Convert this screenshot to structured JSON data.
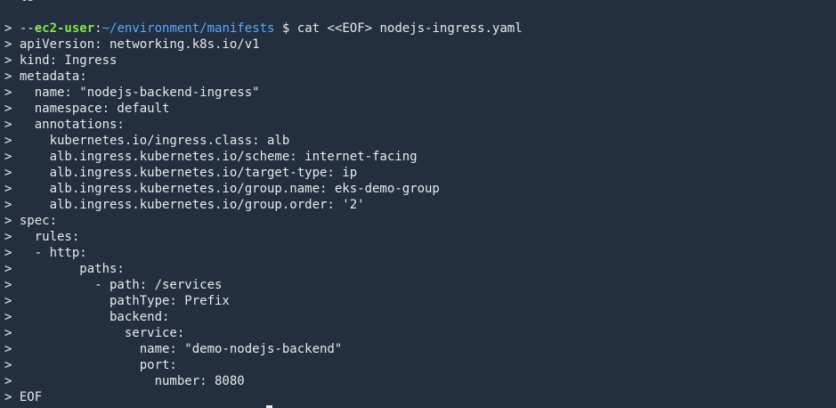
{
  "terminal": {
    "clipped_top_text": "  ls",
    "prompt": {
      "user_host": "ec2-user",
      "separator": ":",
      "path": "~/environment/manifests",
      "symbol": " $ ",
      "command": "cat <<EOF> nodejs-ingress.yaml"
    },
    "lines": [
      "> ---",
      "> apiVersion: networking.k8s.io/v1",
      "> kind: Ingress",
      "> metadata:",
      ">   name: \"nodejs-backend-ingress\"",
      ">   namespace: default",
      ">   annotations:",
      ">     kubernetes.io/ingress.class: alb",
      ">     alb.ingress.kubernetes.io/scheme: internet-facing",
      ">     alb.ingress.kubernetes.io/target-type: ip",
      ">     alb.ingress.kubernetes.io/group.name: eks-demo-group",
      ">     alb.ingress.kubernetes.io/group.order: '2'",
      "> spec:",
      ">   rules:",
      ">   - http:",
      ">         paths:",
      ">           - path: /services",
      ">             pathType: Prefix",
      ">             backend:",
      ">               service:",
      ">                 name: \"demo-nodejs-backend\"",
      ">                 port:",
      ">                   number: 8080",
      "> EOF"
    ]
  }
}
